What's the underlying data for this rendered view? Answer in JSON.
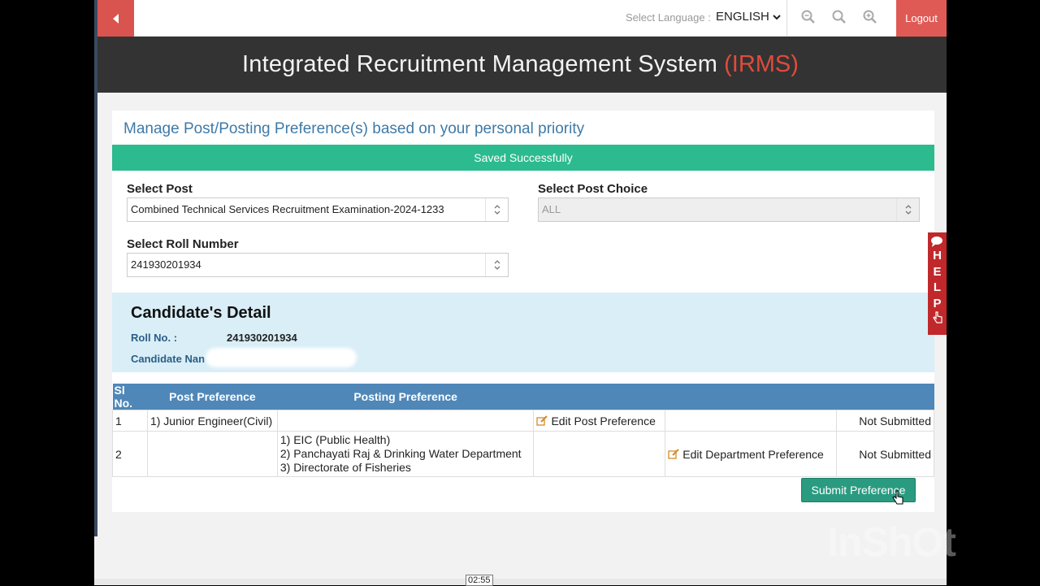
{
  "topbar": {
    "language_label": "Select Language :",
    "language_value": "ENGLISH",
    "logout_label": "Logout"
  },
  "header": {
    "title": "Integrated Recruitment Management System",
    "abbr": "(IRMS)"
  },
  "page": {
    "heading": "Manage Post/Posting Preference(s) based on your personal priority",
    "alert": "Saved Successfully"
  },
  "form": {
    "post_label": "Select Post",
    "post_value": "Combined Technical Services Recruitment Examination-2024-1233",
    "post_choice_label": "Select Post Choice",
    "post_choice_value": "ALL",
    "roll_label": "Select Roll Number",
    "roll_value": "241930201934"
  },
  "candidate": {
    "title": "Candidate's Detail",
    "roll_label": "Roll No. :",
    "roll_value": "241930201934",
    "name_label": "Candidate Nan"
  },
  "table": {
    "headers": {
      "sl": "Sl No.",
      "post": "Post Preference",
      "posting": "Posting Preference"
    },
    "rows": [
      {
        "sl": "1",
        "post": "1) Junior Engineer(Civil)",
        "edit_post": "Edit Post Preference",
        "status": "Not Submitted"
      },
      {
        "sl": "2",
        "posting": [
          "1) EIC (Public Health)",
          "2) Panchayati Raj & Drinking Water Department",
          "3) Directorate of Fisheries"
        ],
        "edit_dept": "Edit Department Preference",
        "status": "Not Submitted"
      }
    ]
  },
  "actions": {
    "submit_label": "Submit Preference"
  },
  "help": {
    "letters": "HELP"
  },
  "video": {
    "timestamp": "02:55",
    "watermark": "InShOt"
  },
  "colors": {
    "accent_red": "#d9534f",
    "header_bg": "#333333",
    "success": "#2cba8f",
    "table_head": "#4f87b8",
    "help_red": "#c0282b"
  }
}
